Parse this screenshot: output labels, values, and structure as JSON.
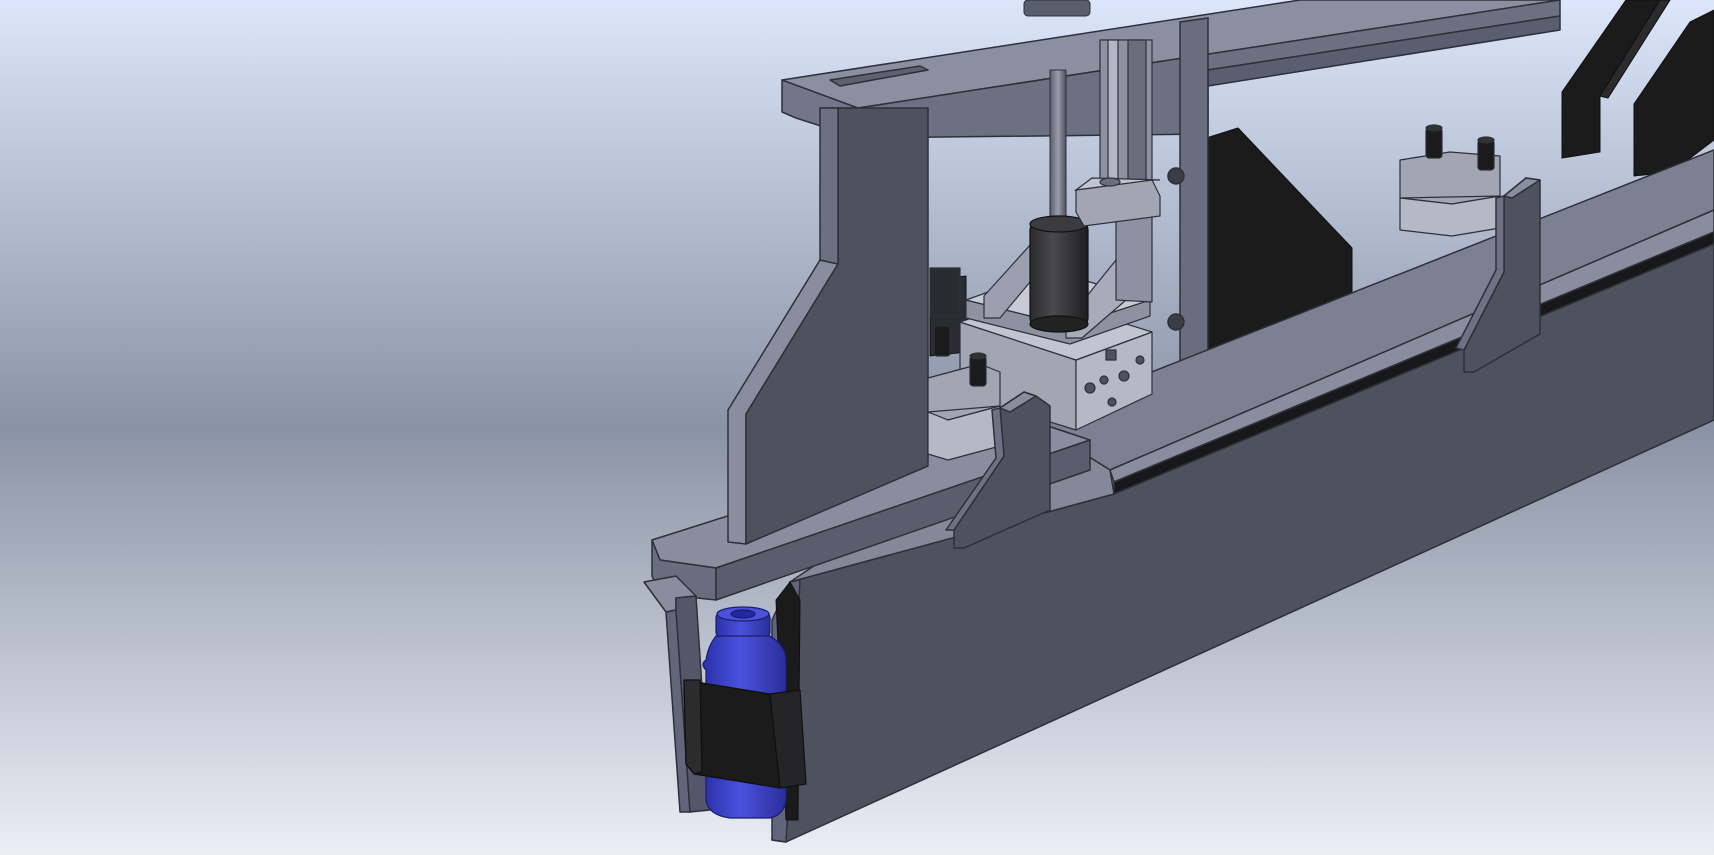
{
  "scene": {
    "background_top": "#dbe6fb",
    "background_mid": "#8a93a6",
    "background_bottom": "#ebeef5",
    "metal_face": "#4e515e",
    "metal_top": "#787b8d",
    "metal_light": "#8c8fa2",
    "metal_edge": "#34363f",
    "black_part": "#1b1b1c",
    "cylinder_block": "#a3a6b2",
    "bottle_color": "#3a40c8",
    "parts": [
      "main-beam",
      "top-crossbar",
      "upright-plate",
      "base-block",
      "mounting-bracket-left",
      "mounting-bracket-right",
      "linear-rail",
      "guide-rod",
      "motor",
      "slider-carriage",
      "pneumatic-block",
      "clamp-assembly-left",
      "clamp-assembly-right",
      "black-fins",
      "bottle",
      "bottle-clip",
      "black-gusset"
    ]
  }
}
